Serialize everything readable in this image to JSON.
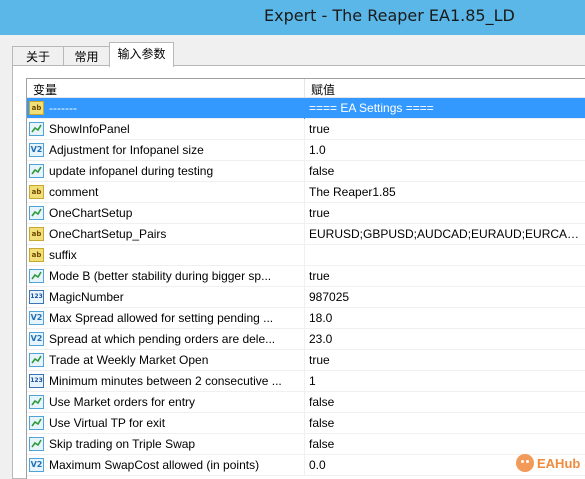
{
  "window": {
    "title": "Expert - The Reaper EA1.85_LD"
  },
  "tabs": [
    {
      "label": "关于"
    },
    {
      "label": "常用"
    },
    {
      "label": "输入参数"
    }
  ],
  "grid": {
    "headers": {
      "variable": "变量",
      "value": "赋值"
    },
    "rows": [
      {
        "type": "ab",
        "name": "-------",
        "value": "==== EA Settings ===="
      },
      {
        "type": "bool",
        "name": "ShowInfoPanel",
        "value": "true"
      },
      {
        "type": "dbl",
        "name": "Adjustment for Infopanel size",
        "value": "1.0"
      },
      {
        "type": "bool",
        "name": "update infopanel during testing",
        "value": "false"
      },
      {
        "type": "ab",
        "name": "comment",
        "value": "The Reaper1.85"
      },
      {
        "type": "bool",
        "name": "OneChartSetup",
        "value": "true"
      },
      {
        "type": "ab",
        "name": "OneChartSetup_Pairs",
        "value": "EURUSD;GBPUSD;AUDCAD;EURAUD;EURCAD..."
      },
      {
        "type": "ab",
        "name": "suffix",
        "value": ""
      },
      {
        "type": "bool",
        "name": "Mode B (better stability during bigger sp...",
        "value": "true"
      },
      {
        "type": "int",
        "name": "MagicNumber",
        "value": "987025"
      },
      {
        "type": "dbl",
        "name": "Max Spread allowed for setting pending ...",
        "value": "18.0"
      },
      {
        "type": "dbl",
        "name": "Spread at which pending orders are dele...",
        "value": "23.0"
      },
      {
        "type": "bool",
        "name": "Trade at Weekly Market Open",
        "value": "true"
      },
      {
        "type": "int",
        "name": "Minimum minutes between 2 consecutive ...",
        "value": "1"
      },
      {
        "type": "bool",
        "name": "Use Market orders for entry",
        "value": "false"
      },
      {
        "type": "bool",
        "name": "Use Virtual TP for exit",
        "value": "false"
      },
      {
        "type": "bool",
        "name": "Skip trading on Triple Swap",
        "value": "false"
      },
      {
        "type": "dbl",
        "name": "Maximum SwapCost allowed (in points)",
        "value": "0.0"
      }
    ],
    "icon_labels": {
      "ab": "ab",
      "dbl": "V2",
      "int": "123"
    }
  },
  "watermark": {
    "text": "EAHub"
  },
  "colors": {
    "titlebar": "#5bb7e8",
    "selection": "#3399ff",
    "accent_watermark": "#f08a3c"
  }
}
